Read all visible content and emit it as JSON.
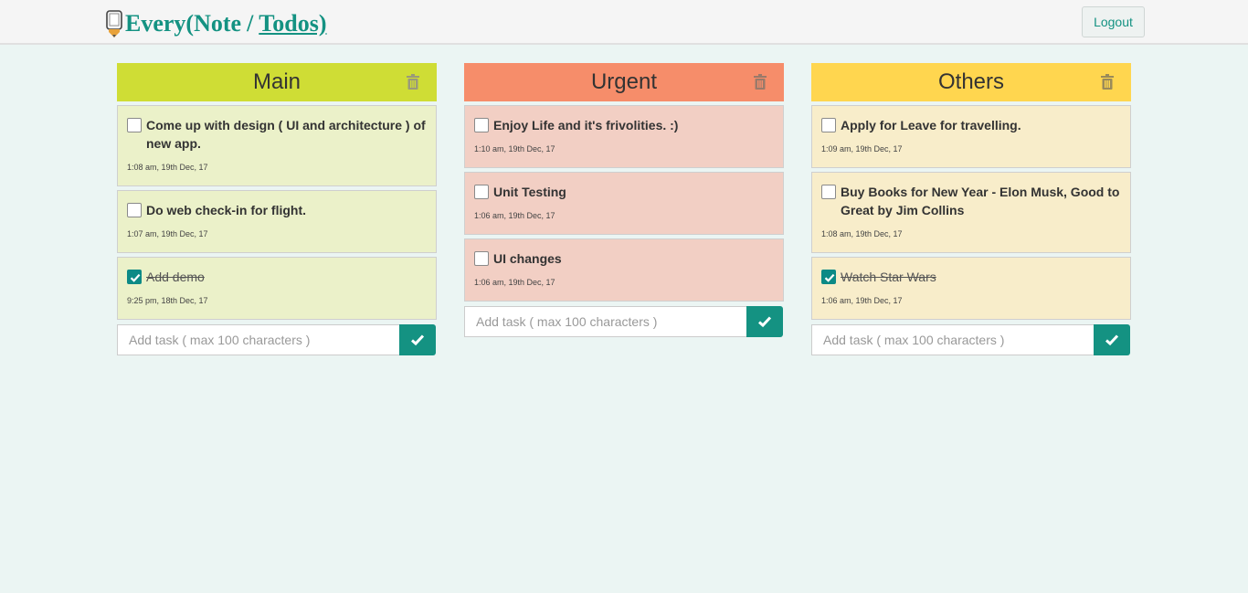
{
  "app": {
    "brand_prefix": "Every(Note",
    "brand_sep": "/",
    "brand_link": "Todos)",
    "logout_label": "Logout"
  },
  "colors": {
    "accent": "#149282",
    "main_header": "#cfdd35",
    "main_card": "#ebf1c9",
    "urgent_header": "#f68d6a",
    "urgent_card": "#f2cfc4",
    "others_header": "#ffd64f",
    "others_card": "#f8edca"
  },
  "boards": [
    {
      "title": "Main",
      "input_placeholder": "Add task ( max 100 characters )",
      "tasks": [
        {
          "text": "Come up with design ( UI and architecture ) of new app.",
          "time": "1:08 am, 19th Dec, 17",
          "done": false
        },
        {
          "text": "Do web check-in for flight.",
          "time": "1:07 am, 19th Dec, 17",
          "done": false
        },
        {
          "text": "Add demo",
          "time": "9:25 pm, 18th Dec, 17",
          "done": true
        }
      ]
    },
    {
      "title": "Urgent",
      "input_placeholder": "Add task ( max 100 characters )",
      "tasks": [
        {
          "text": "Enjoy Life and it's frivolities. :)",
          "time": "1:10 am, 19th Dec, 17",
          "done": false
        },
        {
          "text": "Unit Testing",
          "time": "1:06 am, 19th Dec, 17",
          "done": false
        },
        {
          "text": "UI changes",
          "time": "1:06 am, 19th Dec, 17",
          "done": false
        }
      ]
    },
    {
      "title": "Others",
      "input_placeholder": "Add task ( max 100 characters )",
      "tasks": [
        {
          "text": "Apply for Leave for travelling.",
          "time": "1:09 am, 19th Dec, 17",
          "done": false
        },
        {
          "text": "Buy Books for New Year - Elon Musk, Good to Great by Jim Collins",
          "time": "1:08 am, 19th Dec, 17",
          "done": false
        },
        {
          "text": "Watch Star Wars",
          "time": "1:06 am, 19th Dec, 17",
          "done": true
        }
      ]
    }
  ]
}
